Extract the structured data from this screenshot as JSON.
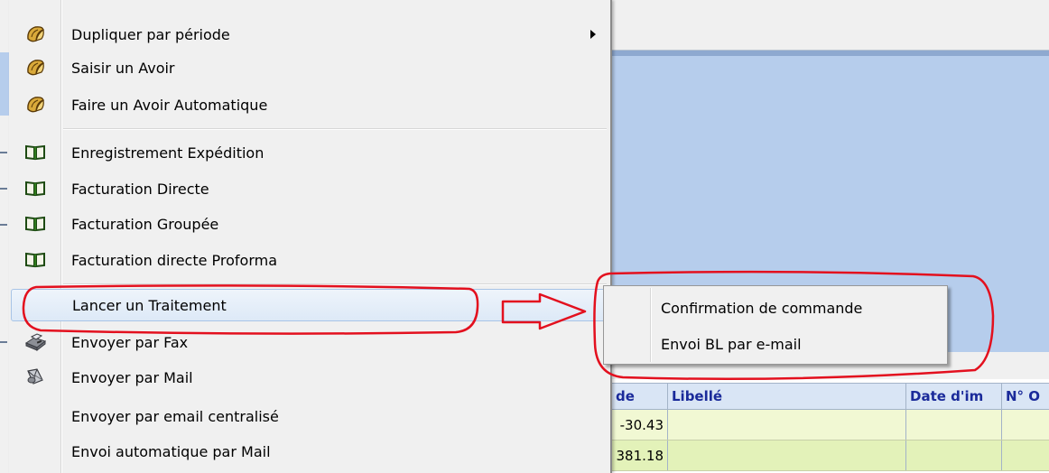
{
  "menu": {
    "items": [
      {
        "id": "dupliquer",
        "label": "Dupliquer par période",
        "icon": "gold-document-icon",
        "has_submenu": true
      },
      {
        "id": "saisir-avoir",
        "label": "Saisir un Avoir",
        "icon": "gold-document-icon"
      },
      {
        "id": "avoir-auto",
        "label": "Faire un Avoir Automatique",
        "icon": "gold-document-icon"
      },
      {
        "id": "enreg-expedition",
        "label": "Enregistrement Expédition",
        "icon": "green-book-icon"
      },
      {
        "id": "fact-directe",
        "label": "Facturation Directe",
        "icon": "green-book-icon"
      },
      {
        "id": "fact-groupee",
        "label": "Facturation Groupée",
        "icon": "green-book-icon"
      },
      {
        "id": "fact-proforma",
        "label": "Facturation directe Proforma",
        "icon": "green-book-icon"
      },
      {
        "id": "lancer-traitement",
        "label": "Lancer un Traitement",
        "icon": "",
        "highlighted": true
      },
      {
        "id": "envoyer-fax",
        "label": "Envoyer par Fax",
        "icon": "fax-icon"
      },
      {
        "id": "envoyer-mail",
        "label": "Envoyer par Mail",
        "icon": "mail-icon"
      },
      {
        "id": "envoyer-email-centralise",
        "label": "Envoyer par email centralisé",
        "icon": ""
      },
      {
        "id": "envoi-auto-mail",
        "label": "Envoi automatique par Mail",
        "icon": ""
      }
    ]
  },
  "submenu": {
    "items": [
      {
        "id": "confirmation-commande",
        "label": "Confirmation de commande"
      },
      {
        "id": "envoi-bl-email",
        "label": "Envoi BL par e-mail"
      }
    ]
  },
  "grid": {
    "columns": [
      "de",
      "Libellé",
      "Date d'im",
      "N° O"
    ],
    "rows": [
      [
        "-30.43",
        "",
        "",
        ""
      ],
      [
        "381.18",
        "",
        "",
        ""
      ]
    ]
  },
  "colors": {
    "annotation_red": "#e3101e",
    "panel_blue": "#b6cdec",
    "grid_header_text": "#1a2a9a",
    "grid_row": "#f1f8d3"
  }
}
